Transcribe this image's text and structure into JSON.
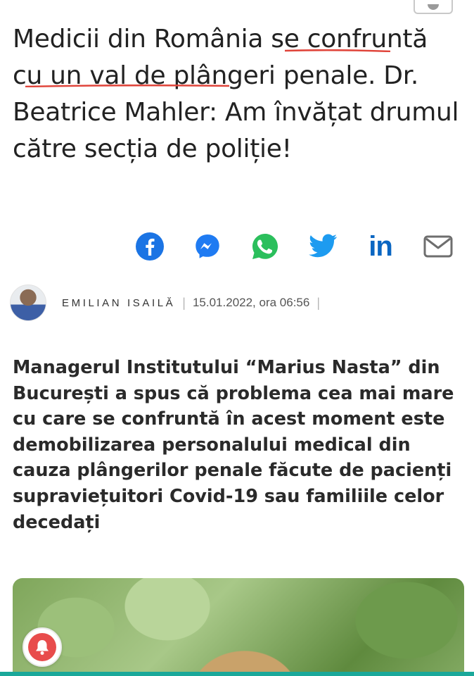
{
  "article": {
    "title": "Medicii din România se confruntă cu un val de plângeri penale. Dr. Beatrice Mahler: Am învățat drumul către secția de poliție!",
    "author": "EMILIAN ISAILĂ",
    "separator": "|",
    "date": "15.01.2022, ora 06:56",
    "lead": "Managerul Institutului “Marius Nasta” din București a spus că problema cea mai mare cu care se confruntă în acest moment este demobilizarea personalului medical din cauza plângerilor penale făcute de pacienți supraviețuitori Covid-19 sau familiile celor decedați"
  },
  "share": {
    "icons": [
      "facebook-icon",
      "messenger-icon",
      "whatsapp-icon",
      "twitter-icon",
      "linkedin-icon",
      "email-icon"
    ],
    "linkedin_text": "in"
  },
  "colors": {
    "facebook": "#1b74e4",
    "messenger": "#1f7bf2",
    "whatsapp": "#2bbf5c",
    "twitter": "#1d9bf0",
    "linkedin": "#0a66c2",
    "email": "#6e6e6e",
    "annotation_underline": "#e0453b",
    "bottom_bar": "#1aa89a",
    "notification_bell": "#e84c4c"
  }
}
